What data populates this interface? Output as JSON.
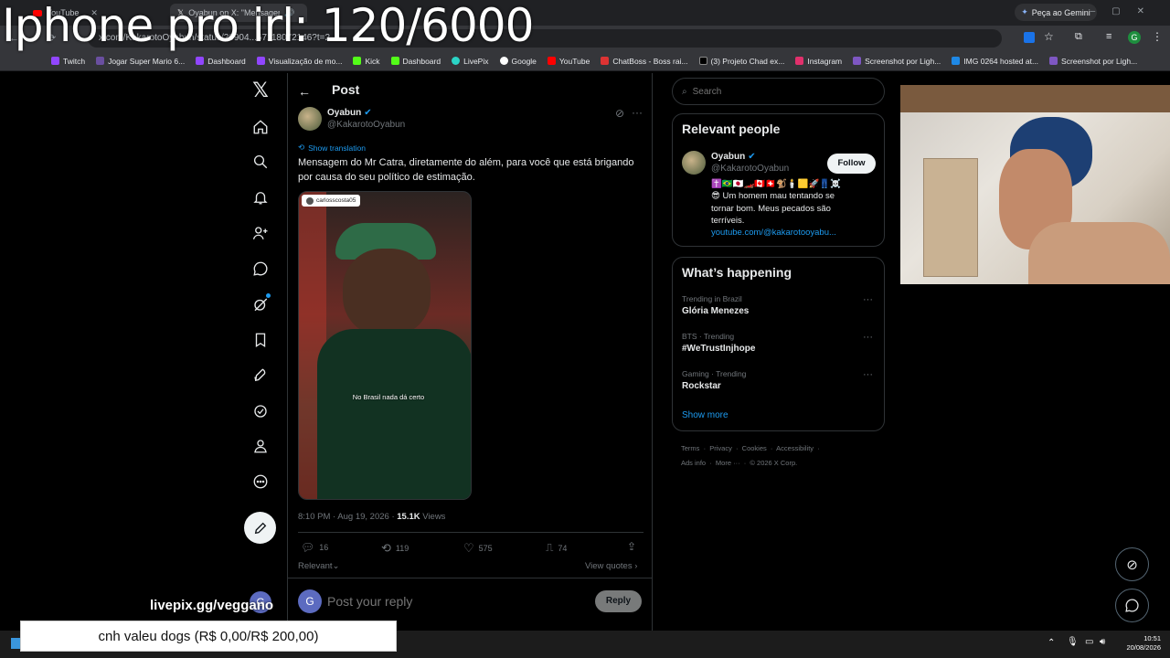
{
  "overlay_title": "Iphone pro irl: 120/6000",
  "browser": {
    "tabs": [
      {
        "label": "YouTube"
      },
      {
        "label": "Oyabun on X: \"Mensagem"
      }
    ],
    "url": "x.com/KakarotoOyabun/status/20904...67118072146?t=2...",
    "gemini_label": "Peça ao Gemini",
    "bookmarks": [
      "Twitch",
      "Jogar Super Mario 6...",
      "Dashboard",
      "Visualização de mo...",
      "Kick",
      "Dashboard",
      "LivePix",
      "Google",
      "YouTube",
      "ChatBoss - Boss rai...",
      "(3) Projeto Chad ex...",
      "Instagram",
      "Screenshot por Ligh...",
      "IMG 0264 hosted at...",
      "Screenshot por Ligh..."
    ]
  },
  "post": {
    "header": "Post",
    "author_name": "Oyabun",
    "author_handle": "@KakarotoOyabun",
    "show_translation": "Show translation",
    "text": "Mensagem do Mr Catra, diretamente do além, para você que está brigando por causa do seu político de estimação.",
    "video_tag": "carlosscosta05",
    "video_caption": "No Brasil nada dá certo",
    "timestamp": "8:10 PM · Aug 19, 2026 · ",
    "views_count": "15.1K",
    "views_label": " Views",
    "replies": "16",
    "reposts": "119",
    "likes": "575",
    "bookmarks": "74",
    "sort_label": "Relevant",
    "view_quotes": "View quotes",
    "reply_placeholder": "Post your reply",
    "reply_button": "Reply",
    "reply_avatar_letter": "G"
  },
  "search": {
    "placeholder": "Search"
  },
  "relevant_people": {
    "title": "Relevant people",
    "name": "Oyabun",
    "handle": "@KakarotoOyabun",
    "follow_label": "Follow",
    "bio_emojis": "✝️🇧🇷🇯🇵🏎️🇨🇦🇨🇭🐒🕯️🟨🚀👖☠️",
    "bio": "😎 Um homem mau tentando se tornar bom. Meus pecados são terríveis.",
    "link": "youtube.com/@kakarotooyabu..."
  },
  "whats_happening": {
    "title": "What’s happening",
    "trends": [
      {
        "context": "Trending in Brazil",
        "name": "Glória Menezes"
      },
      {
        "context": "BTS · Trending",
        "name": "#WeTrustInjhope"
      },
      {
        "context": "Gaming · Trending",
        "name": "Rockstar"
      }
    ],
    "show_more": "Show more"
  },
  "footer_links": {
    "line1": "Terms  ·  Privacy  ·  Cookies  ·  Accessibility  ·",
    "line2": "Ads info  ·  More ···  ·  © 2026 X Corp."
  },
  "overlay": {
    "livepix": "livepix.gg/veggano",
    "donation": "cnh valeu dogs (R$ 0,00/R$ 200,00)"
  },
  "taskbar": {
    "time": "10:51",
    "date": "20/08/2026"
  },
  "colors": {
    "accent": "#1d9bf0",
    "background": "#000000",
    "border": "#2f3336"
  }
}
